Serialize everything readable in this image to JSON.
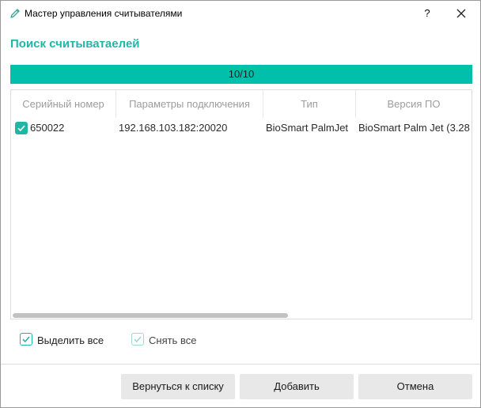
{
  "window": {
    "title": "Мастер управления считывателями",
    "help_label": "?"
  },
  "heading": "Поиск считыватаелей",
  "progress": {
    "text": "10/10",
    "fraction": 1.0,
    "color": "#00c0ac"
  },
  "table": {
    "columns": [
      "Серийный номер",
      "Параметры подключения",
      "Тип",
      "Версия ПО"
    ],
    "rows": [
      {
        "checked": true,
        "serial": "650022",
        "connection": "192.168.103.182:20020",
        "type": "BioSmart PalmJet",
        "version": "BioSmart Palm Jet (3.28"
      }
    ]
  },
  "actions": {
    "select_all": "Выделить все",
    "deselect_all": "Снять все"
  },
  "buttons": {
    "back": "Вернуться к списку",
    "add": "Добавить",
    "cancel": "Отмена"
  },
  "colors": {
    "accent": "#21b6a8"
  }
}
